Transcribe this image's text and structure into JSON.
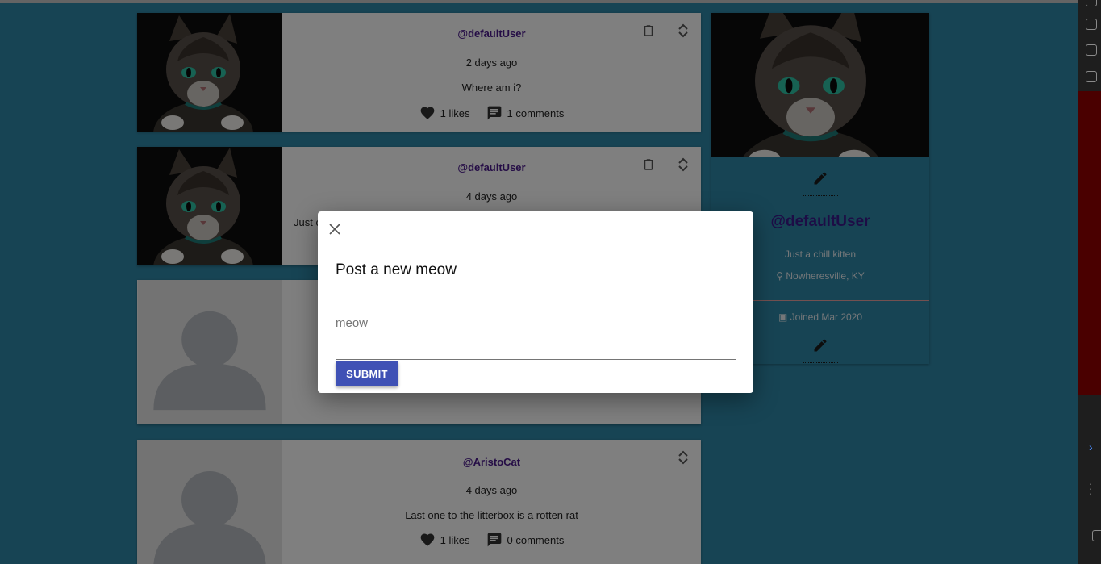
{
  "posts": [
    {
      "handle": "@defaultUser",
      "date": "2 days ago",
      "text": "Where am i?",
      "likes": "1 likes",
      "comments": "1 comments"
    },
    {
      "handle": "@defaultUser",
      "date": "4 days ago",
      "text": "Just c"
    },
    {
      "handle": "",
      "date": "",
      "text": ""
    },
    {
      "handle": "@AristoCat",
      "date": "4 days ago",
      "text": "Last one to the litterbox is a rotten rat",
      "likes": "1 likes",
      "comments": "0 comments"
    }
  ],
  "profile": {
    "handle": "@defaultUser",
    "bio": "Just a chill kitten",
    "location": "Nowheresville, KY",
    "joined": "Joined Mar 2020"
  },
  "modal": {
    "title": "Post a new meow",
    "input_placeholder": "meow",
    "submit_label": "SUBMIT"
  },
  "icons": {
    "like": "heart-icon",
    "comment": "comment-icon",
    "delete": "trash-icon",
    "expand": "unfold-icon",
    "edit": "pencil-icon",
    "location": "location-pin-icon",
    "calendar": "calendar-icon",
    "close": "close-icon"
  }
}
